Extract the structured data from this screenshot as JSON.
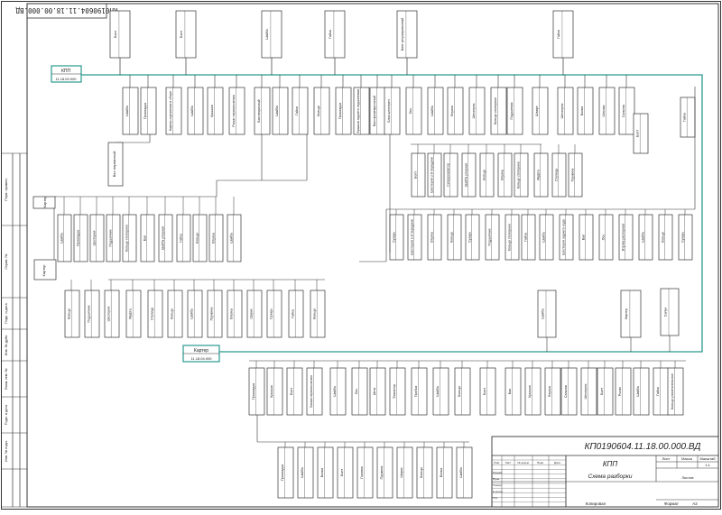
{
  "sheet": {
    "rotated_stamp": "КП0190604.11.18.00.000.ВД",
    "doc_code": "КП0190604.11.18.00.000.ВД",
    "assembly_name": "КПП",
    "doc_title": "Схема разборки",
    "sheet_label": "Лист",
    "sheets_label": "Листов",
    "mass_label": "Масса",
    "scale_label": "Масштаб",
    "scale_value": "1:1",
    "copied_label": "Копировал",
    "format_label": "Формат",
    "format_value": "A2",
    "stamp_rows": [
      "Изм.",
      "Лист",
      "№ докум.",
      "Подп.",
      "Дата"
    ],
    "stamp_roles": [
      "Разраб.",
      "Пров.",
      "Т.контр.",
      "Н.контр.",
      "Утв."
    ],
    "side_labels": [
      "Перв. примен.",
      "Справ. №",
      "Подп. и дата",
      "Инв. № дубл.",
      "Взам. инв. №",
      "Подп. и дата",
      "Инв. № подл."
    ]
  },
  "nodes": {
    "main": {
      "name": "КПП",
      "code": "11.18.00.000"
    },
    "sub1": {
      "name": "Картер",
      "code": "11.18.01.000"
    },
    "sub2": {
      "name": "Картер",
      "code": "11.18.02.000"
    },
    "sub3": {
      "name": "Вал первичный",
      "code": "11.18.03.000"
    },
    "sub4": {
      "name": "Картер",
      "code": "11.18.04.000"
    },
    "top_row": [
      "Болт",
      "Болт",
      "Шайба",
      "Гайка",
      "Винт регулировочный",
      "Гайка",
      "Шайба"
    ],
    "upper_row": [
      "Шайба",
      "Прокладка",
      "Картер сцепления в сборе",
      "Шайба",
      "Крышка",
      "Рычаг переключения",
      "Вал вторичный",
      "Шайба",
      "Гайка",
      "Кольцо",
      "Прокладка",
      "Крышка заднего подшипника",
      "Вал промежуточный",
      "Блок шестерен",
      "Ось",
      "Шайба",
      "Втулка",
      "Шестерня",
      "Кольцо стопорное",
      "Подшипник",
      "Штифт",
      "Шестерня",
      "Вилка",
      "Шпонка",
      "Сальник",
      "Фланец"
    ],
    "center_group": [
      "Болт",
      "Шестерня 2-й передачи",
      "Синхронизатор",
      "Шайба упорная",
      "Кольцо",
      "Втулка",
      "Кольцо стопорное",
      "Муфта",
      "Ступица",
      "Пружина",
      "Шестерня 3-й передачи",
      "Подшипник",
      "Кольцо упорное"
    ],
    "center_group2": [
      "Сухарь",
      "Шестерня 1-й передачи",
      "Втулка",
      "Кольцо",
      "Сухарь",
      "Подшипник",
      "Кольцо стопорное",
      "Гайка",
      "Шайба",
      "Шестерня заднего хода",
      "Вал",
      "Ось",
      "Втулка распорная",
      "Шайба",
      "Кольцо"
    ],
    "left_upper": [
      "Шайба",
      "Прокладка",
      "Шестерня",
      "Подшипник",
      "Кольцо стопорное",
      "Вал",
      "Шайба упорная",
      "Гайка",
      "Кольцо",
      "Втулка",
      "Шайба"
    ],
    "left_lower": [
      "Кольцо",
      "Подшипник",
      "Шестерня",
      "Муфта",
      "Ступица",
      "Кольцо",
      "Шайба",
      "Пружина",
      "Втулка",
      "Шарик",
      "Сухарь",
      "Гайка"
    ],
    "bottom_row": [
      "Прокладка",
      "Крышка",
      "Болт",
      "Вилка переключения",
      "Шайба",
      "Ось",
      "Шток",
      "Фиксатор",
      "Пробка",
      "Шайба",
      "Кольцо",
      "Болт",
      "Вал",
      "Крышка",
      "Втулка",
      "Сальник",
      "Шестерня",
      "Болт",
      "Рычаг",
      "Шайба",
      "Гайка",
      "Кольцо уплотнительное",
      "Шток",
      "Шайба"
    ],
    "bottom_sub": [
      "Прокладка",
      "Шайба",
      "Вилка",
      "Болт",
      "Головка",
      "Пружина",
      "Шарик",
      "Кольцо",
      "Вилка",
      "Шайба",
      "Гайка",
      "Пробка",
      "Крышка"
    ],
    "right_group": [
      "Шайба",
      "Картер",
      "Сапун",
      "Болт",
      "Гайка"
    ]
  }
}
